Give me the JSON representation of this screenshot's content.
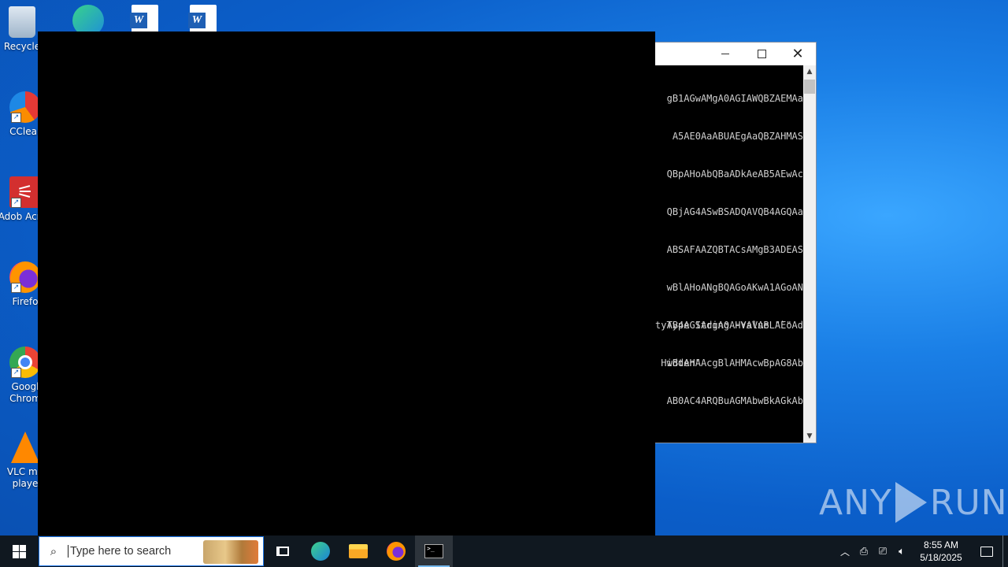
{
  "desktop": {
    "icons": [
      {
        "id": "recycle-bin",
        "label": "Recycle"
      },
      {
        "id": "ccleaner",
        "label": "CClear"
      },
      {
        "id": "adobe-acrobat",
        "label": "Adob Acrob"
      },
      {
        "id": "firefox",
        "label": "Firefo"
      },
      {
        "id": "google-chrome",
        "label": "Googl Chrom"
      },
      {
        "id": "vlc",
        "label": "VLC me playe"
      }
    ]
  },
  "powershell_window": {
    "lines": [
      "gB1AGwAMgA0AGIAWQBZAEMAa",
      "A5AE0AaABUAEgAaQBZAHMAS",
      "QBpAHoAbQBaADkAeAB5AEwAc",
      "QBjAG4ASwBSADQAVQB4AGQAa",
      "ABSAFAAZQBTACsAMgB3ADEAS",
      "wBlAHoANgBQAGoAKwA1AGoAN",
      "AB4AGIAdgA0AHYAVABLAEoAd",
      "wBtAHAAcgBlAHMAcwBpAG8Ab",
      "AB0AC4ARQBuAGMAbwBkAGkAb"
    ],
    "lines2": [
      "tyType String -Value \"`\"",
      " Hidden\""
    ]
  },
  "watermark": {
    "left": "ANY",
    "right": "RUN"
  },
  "taskbar": {
    "search_placeholder": "Type here to search",
    "time": "8:55 AM",
    "date": "5/18/2025"
  }
}
